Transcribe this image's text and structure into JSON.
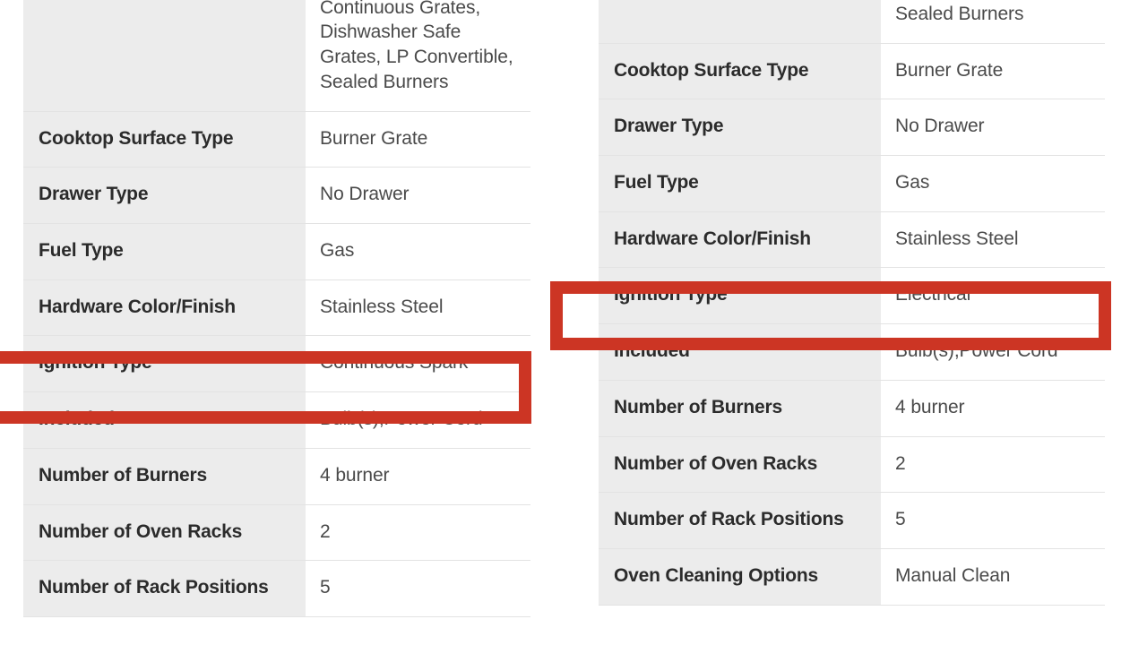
{
  "colors": {
    "highlight": "#cc3524",
    "label_bg": "#ececec",
    "value_bg": "#ffffff",
    "label_text": "#2b2b2b",
    "value_text": "#4a4a4a",
    "divider": "#e3e3e3"
  },
  "panels": [
    {
      "id": "left",
      "name": "left-spec-panel",
      "rows": [
        {
          "label": "",
          "value": "Continuous Grates, Dishwasher Safe Grates, LP Convertible, Sealed Burners",
          "clipped": true
        },
        {
          "label": "Cooktop Surface Type",
          "value": "Burner Grate"
        },
        {
          "label": "Drawer Type",
          "value": "No Drawer"
        },
        {
          "label": "Fuel Type",
          "value": "Gas"
        },
        {
          "label": "Hardware Color/Finish",
          "value": "Stainless Steel"
        },
        {
          "label": "Ignition Type",
          "value": "Continuous Spark",
          "highlighted": true
        },
        {
          "label": "Included",
          "value": "Bulb(s),Power Cord"
        },
        {
          "label": "Number of Burners",
          "value": "4 burner"
        },
        {
          "label": "Number of Oven Racks",
          "value": "2"
        },
        {
          "label": "Number of Rack Positions",
          "value": "5"
        }
      ]
    },
    {
      "id": "right",
      "name": "right-spec-panel",
      "rows": [
        {
          "label": "",
          "value": "Grates, LP Convertible, Sealed Burners",
          "clipped": true
        },
        {
          "label": "Cooktop Surface Type",
          "value": "Burner Grate"
        },
        {
          "label": "Drawer Type",
          "value": "No Drawer"
        },
        {
          "label": "Fuel Type",
          "value": "Gas"
        },
        {
          "label": "Hardware Color/Finish",
          "value": "Stainless Steel"
        },
        {
          "label": "Ignition Type",
          "value": "Electrical",
          "highlighted": true
        },
        {
          "label": "Included",
          "value": "Bulb(s),Power Cord"
        },
        {
          "label": "Number of Burners",
          "value": "4 burner"
        },
        {
          "label": "Number of Oven Racks",
          "value": "2"
        },
        {
          "label": "Number of Rack Positions",
          "value": "5"
        },
        {
          "label": "Oven Cleaning Options",
          "value": "Manual Clean"
        }
      ]
    }
  ],
  "annotations": [
    {
      "name": "highlight-box-left",
      "target_label": "Ignition Type",
      "target_value": "Continuous Spark"
    },
    {
      "name": "highlight-box-right",
      "target_label": "Ignition Type",
      "target_value": "Electrical"
    }
  ]
}
